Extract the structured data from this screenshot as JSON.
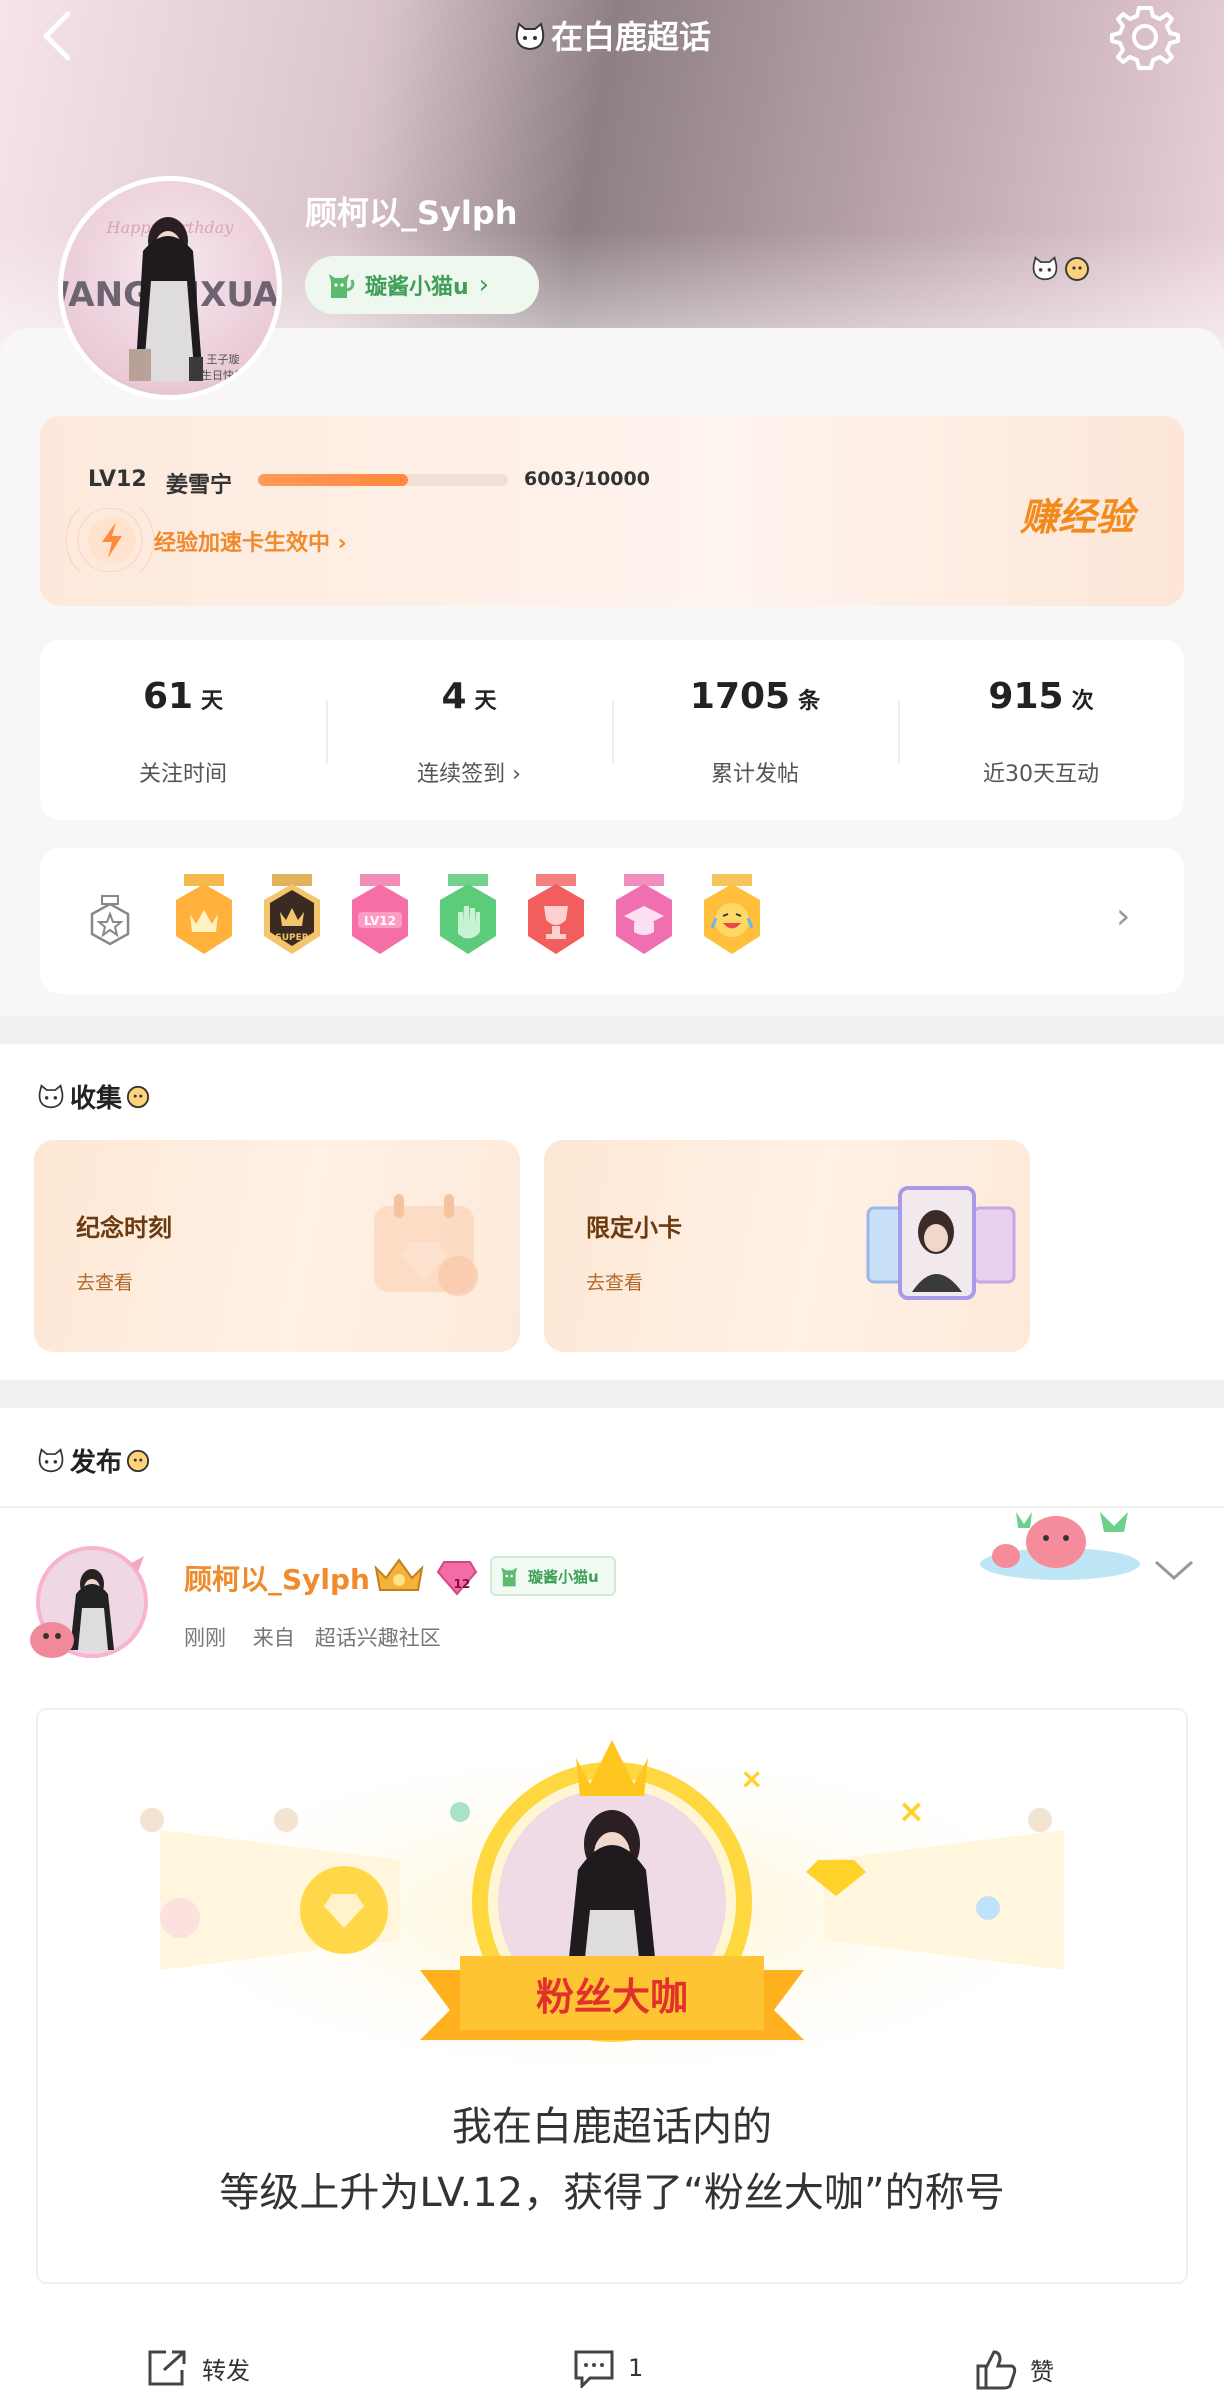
{
  "header": {
    "title": "在白鹿超话"
  },
  "profile": {
    "username": "顾柯以_Sylph",
    "group_label": "璇酱小猫u",
    "avatar_text_top": "Happy birthday",
    "avatar_text_mid": "WANG ZIXUAN",
    "avatar_caption_1": "王子璇",
    "avatar_caption_2": "生日快乐"
  },
  "level": {
    "tag": "LV12",
    "name": "姜雪宁",
    "progress_text": "6003/10000",
    "progress_fraction": 0.6003,
    "boost_text": "经验加速卡生效中",
    "earn_label": "赚经验"
  },
  "stats": [
    {
      "value": "61",
      "unit": "天",
      "label": "关注时间"
    },
    {
      "value": "4",
      "unit": "天",
      "label": "连续签到 ›"
    },
    {
      "value": "1705",
      "unit": "条",
      "label": "累计发帖"
    },
    {
      "value": "915",
      "unit": "次",
      "label": "近30天互动"
    }
  ],
  "badges": {
    "icons": [
      "crown-badge",
      "super-badge",
      "lv12-badge",
      "hand-badge",
      "trophy-badge",
      "grad-cap-badge",
      "laugh-badge"
    ],
    "super_text": "SUPER",
    "lv_text": "LV12"
  },
  "collection": {
    "title": "收集",
    "cards": [
      {
        "title": "纪念时刻",
        "sub": "去查看"
      },
      {
        "title": "限定小卡",
        "sub": "去查看"
      }
    ]
  },
  "publish": {
    "title": "发布"
  },
  "post": {
    "author": "顾柯以_Sylph",
    "group_tag": "璇酱小猫u",
    "level_badge": "12",
    "time": "刚刚",
    "source_prefix": "来自",
    "source": "超话兴趣社区",
    "banner_label": "粉丝大咖",
    "line1": "我在白鹿超话内的",
    "line2": "等级上升为LV.12，获得了“粉丝大咖”的称号"
  },
  "actions": {
    "repost": "转发",
    "comment_count": "1",
    "like": "赞"
  },
  "colors": {
    "accent_orange": "#f08a2c",
    "group_green": "#3f9e58",
    "progress": "#ff8a3d"
  }
}
